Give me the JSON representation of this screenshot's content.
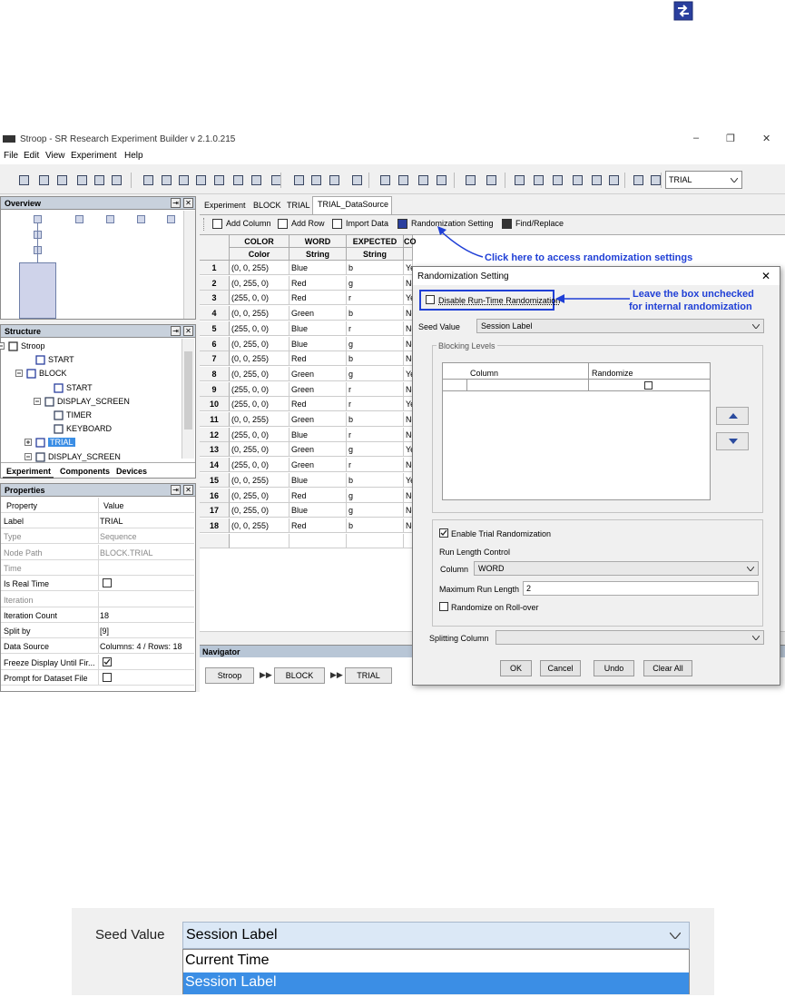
{
  "window": {
    "title": "Stroop - SR Research Experiment Builder v 2.1.0.215",
    "menu": [
      "File",
      "Edit",
      "View",
      "Experiment",
      "Help"
    ],
    "toolbar_select": "TRIAL"
  },
  "overview": {
    "title": "Overview"
  },
  "structure": {
    "title": "Structure",
    "nodes": [
      "Stroop",
      "START",
      "BLOCK",
      "START",
      "DISPLAY_SCREEN",
      "TIMER",
      "KEYBOARD",
      "TRIAL",
      "DISPLAY_SCREEN"
    ],
    "tabs": [
      "Experiment",
      "Components",
      "Devices"
    ]
  },
  "properties": {
    "title": "Properties",
    "header": {
      "property": "Property",
      "value": "Value"
    },
    "rows": [
      {
        "key": "Label",
        "value": "TRIAL"
      },
      {
        "key": "Type",
        "value": "Sequence"
      },
      {
        "key": "Node Path",
        "value": "BLOCK.TRIAL"
      },
      {
        "key": "Time",
        "value": ""
      },
      {
        "key": "Is Real Time",
        "value": ""
      },
      {
        "key": "Iteration",
        "value": ""
      },
      {
        "key": "Iteration Count",
        "value": "18"
      },
      {
        "key": "Split by",
        "value": "[9]"
      },
      {
        "key": "Data Source",
        "value": "Columns: 4 / Rows: 18"
      },
      {
        "key": "Freeze Display Until Fir...",
        "value": ""
      },
      {
        "key": "Prompt for Dataset File",
        "value": ""
      }
    ]
  },
  "editor": {
    "tabs": [
      "Experiment",
      "BLOCK",
      "TRIAL",
      "TRIAL_DataSource"
    ],
    "ds_toolbar": [
      "Add Column",
      "Add Row",
      "Import Data",
      "Randomization Setting",
      "Find/Replace"
    ],
    "columns": [
      {
        "name": "COLOR",
        "type": "Color"
      },
      {
        "name": "WORD",
        "type": "String"
      },
      {
        "name": "EXPECTED",
        "type": "String"
      },
      {
        "name": "CO",
        "type": ""
      }
    ],
    "rows": [
      [
        "(0, 0, 255)",
        "Blue",
        "b",
        "Ye"
      ],
      [
        "(0, 255, 0)",
        "Red",
        "g",
        "No"
      ],
      [
        "(255, 0, 0)",
        "Red",
        "r",
        "Ye"
      ],
      [
        "(0, 0, 255)",
        "Green",
        "b",
        "No"
      ],
      [
        "(255, 0, 0)",
        "Blue",
        "r",
        "No"
      ],
      [
        "(0, 255, 0)",
        "Blue",
        "g",
        "No"
      ],
      [
        "(0, 0, 255)",
        "Red",
        "b",
        "No"
      ],
      [
        "(0, 255, 0)",
        "Green",
        "g",
        "Ye"
      ],
      [
        "(255, 0, 0)",
        "Green",
        "r",
        "No"
      ],
      [
        "(255, 0, 0)",
        "Red",
        "r",
        "Ye"
      ],
      [
        "(0, 0, 255)",
        "Green",
        "b",
        "No"
      ],
      [
        "(255, 0, 0)",
        "Blue",
        "r",
        "No"
      ],
      [
        "(0, 255, 0)",
        "Green",
        "g",
        "Ye"
      ],
      [
        "(255, 0, 0)",
        "Green",
        "r",
        "No"
      ],
      [
        "(0, 0, 255)",
        "Blue",
        "b",
        "Ye"
      ],
      [
        "(0, 255, 0)",
        "Red",
        "g",
        "No"
      ],
      [
        "(0, 255, 0)",
        "Blue",
        "g",
        "No"
      ],
      [
        "(0, 0, 255)",
        "Red",
        "b",
        "No"
      ]
    ]
  },
  "navigator": {
    "title": "Navigator",
    "crumbs": [
      "Stroop",
      "BLOCK",
      "TRIAL"
    ]
  },
  "dialog": {
    "title": "Randomization Setting",
    "disable_label": "Disable Run-Time Randomization",
    "seed_label": "Seed Value",
    "seed_value": "Session Label",
    "blocking_levels": "Blocking Levels",
    "col_column": "Column",
    "col_randomize": "Randomize",
    "enable_trial": "Enable Trial Randomization",
    "run_length_control": "Run Length Control",
    "column_label": "Column",
    "column_value": "WORD",
    "max_run_label": "Maximum Run Length",
    "max_run_value": "2",
    "rollover": "Randomize on Roll-over",
    "splitting": "Splitting Column",
    "buttons": [
      "OK",
      "Cancel",
      "Undo",
      "Clear All"
    ]
  },
  "annotations": {
    "randomization": "Click here to access randomization settings",
    "leave_line1": "Leave the box unchecked",
    "leave_line2": "for internal randomization"
  },
  "zoom": {
    "label": "Seed Value",
    "selected": "Session Label",
    "options": [
      "Current Time",
      "Session Label"
    ]
  },
  "colors": {
    "accent": "#1f3fd6",
    "selection": "#3b8ee5",
    "panel_header": "#c8d1dc"
  }
}
